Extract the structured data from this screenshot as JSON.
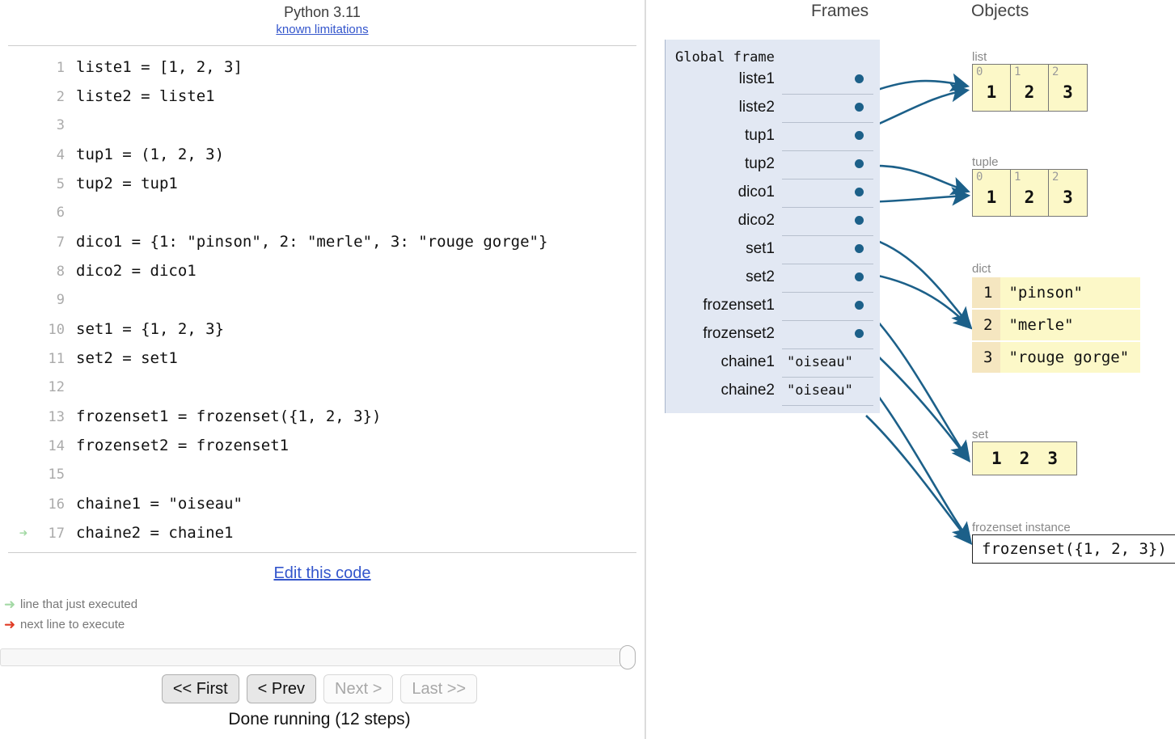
{
  "header": {
    "version": "Python 3.11",
    "limitations_link": "known limitations"
  },
  "code": {
    "lines": [
      {
        "n": "1",
        "text": "liste1 = [1, 2, 3]",
        "arrow": ""
      },
      {
        "n": "2",
        "text": "liste2 = liste1",
        "arrow": ""
      },
      {
        "n": "3",
        "text": "",
        "arrow": ""
      },
      {
        "n": "4",
        "text": "tup1 = (1, 2, 3)",
        "arrow": ""
      },
      {
        "n": "5",
        "text": "tup2 = tup1",
        "arrow": ""
      },
      {
        "n": "6",
        "text": "",
        "arrow": ""
      },
      {
        "n": "7",
        "text": "dico1 = {1: \"pinson\", 2: \"merle\", 3: \"rouge gorge\"}",
        "arrow": ""
      },
      {
        "n": "8",
        "text": "dico2 = dico1",
        "arrow": ""
      },
      {
        "n": "9",
        "text": "",
        "arrow": ""
      },
      {
        "n": "10",
        "text": "set1 = {1, 2, 3}",
        "arrow": ""
      },
      {
        "n": "11",
        "text": "set2 = set1",
        "arrow": ""
      },
      {
        "n": "12",
        "text": "",
        "arrow": ""
      },
      {
        "n": "13",
        "text": "frozenset1 = frozenset({1, 2, 3})",
        "arrow": ""
      },
      {
        "n": "14",
        "text": "frozenset2 = frozenset1",
        "arrow": ""
      },
      {
        "n": "15",
        "text": "",
        "arrow": ""
      },
      {
        "n": "16",
        "text": "chaine1 = \"oiseau\"",
        "arrow": ""
      },
      {
        "n": "17",
        "text": "chaine2 = chaine1",
        "arrow": "➜"
      }
    ]
  },
  "edit_link": "Edit this code",
  "legend": {
    "just_executed_glyph": "➜",
    "just_executed": "line that just executed",
    "next_line_glyph": "➜",
    "next_line": "next line to execute"
  },
  "controls": {
    "first": "<< First",
    "prev": "< Prev",
    "next": "Next >",
    "last": "Last >>",
    "status": "Done running (12 steps)"
  },
  "panes": {
    "frames_title": "Frames",
    "objects_title": "Objects"
  },
  "frame": {
    "title": "Global frame",
    "variables": [
      {
        "name": "liste1",
        "value": "",
        "is_pointer": true
      },
      {
        "name": "liste2",
        "value": "",
        "is_pointer": true
      },
      {
        "name": "tup1",
        "value": "",
        "is_pointer": true
      },
      {
        "name": "tup2",
        "value": "",
        "is_pointer": true
      },
      {
        "name": "dico1",
        "value": "",
        "is_pointer": true
      },
      {
        "name": "dico2",
        "value": "",
        "is_pointer": true
      },
      {
        "name": "set1",
        "value": "",
        "is_pointer": true
      },
      {
        "name": "set2",
        "value": "",
        "is_pointer": true
      },
      {
        "name": "frozenset1",
        "value": "",
        "is_pointer": true
      },
      {
        "name": "frozenset2",
        "value": "",
        "is_pointer": true
      },
      {
        "name": "chaine1",
        "value": "\"oiseau\"",
        "is_pointer": false
      },
      {
        "name": "chaine2",
        "value": "\"oiseau\"",
        "is_pointer": false
      }
    ]
  },
  "objects": {
    "list": {
      "label": "list",
      "indices": [
        "0",
        "1",
        "2"
      ],
      "values": [
        "1",
        "2",
        "3"
      ]
    },
    "tuple": {
      "label": "tuple",
      "indices": [
        "0",
        "1",
        "2"
      ],
      "values": [
        "1",
        "2",
        "3"
      ]
    },
    "dict": {
      "label": "dict",
      "entries": [
        {
          "key": "1",
          "value": "\"pinson\""
        },
        {
          "key": "2",
          "value": "\"merle\""
        },
        {
          "key": "3",
          "value": "\"rouge gorge\""
        }
      ]
    },
    "set": {
      "label": "set",
      "items": [
        "1",
        "2",
        "3"
      ]
    },
    "frozenset": {
      "label": "frozenset instance",
      "text": "frozenset({1, 2, 3})"
    }
  },
  "colors": {
    "link": "#3355cc",
    "frame_bg": "#e2e8f3",
    "object_bg": "#fcf8c8",
    "dict_key_bg": "#f5e6c0",
    "pointer": "#1c6089",
    "green_arrow": "#a3d9a5",
    "red_arrow": "#e03b24"
  }
}
